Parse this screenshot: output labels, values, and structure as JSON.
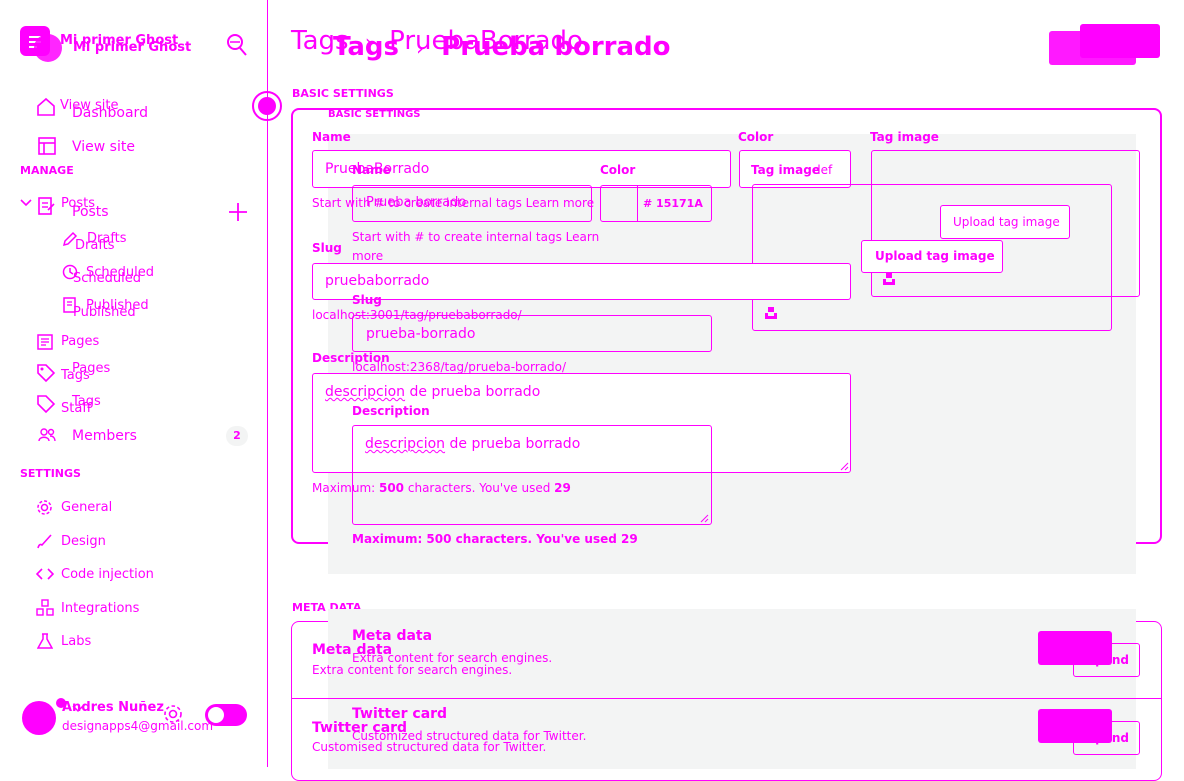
{
  "site": {
    "name": "Mi primer Ghost"
  },
  "nav": {
    "view_site": "View site",
    "dashboard": "Dashboard",
    "view_site_2": "View site",
    "manage_header": "MANAGE",
    "posts": "Posts",
    "drafts": "Drafts",
    "scheduled": "Scheduled",
    "published": "Published",
    "pages": "Pages",
    "tags": "Tags",
    "staff": "Staff",
    "members": "Members",
    "members_count": "2",
    "settings_header": "SETTINGS",
    "general": "General",
    "design": "Design",
    "code_injection": "Code injection",
    "integrations": "Integrations",
    "labs": "Labs"
  },
  "user": {
    "name": "Andres Nuñez",
    "email": "designapps4@gmail.com"
  },
  "header": {
    "crumb_a": "Tags",
    "sep_a": "›",
    "title_a": "PruebaBorrado",
    "crumb_b": "Tags",
    "sep_b": "›",
    "title_b": "Prueba borrado"
  },
  "basic": {
    "section_a": "BASIC SETTINGS",
    "section_b": "BASIC SETTINGS",
    "name_label": "Name",
    "name_value": "PruebaBorrado",
    "name_label_b": "Name",
    "name_value_b": "Prueba borrado",
    "name_hint_a": "Start with # to create internal tags Learn more",
    "name_hint_b1": "Start with # to create internal tags Learn",
    "name_hint_b2": "more",
    "color_label_a": "Color",
    "color_label_b": "Color",
    "color_hex_a": "15171A",
    "color_hex_b": "# 15171A",
    "color_def": "def",
    "tag_image_label_a": "Tag image",
    "tag_image_label_b": "Tag image",
    "upload_a": "Upload tag image",
    "upload_b": "Upload tag image",
    "slug_label_a": "Slug",
    "slug_value_a": "pruebaborrado",
    "slug_url_a": "localhost:3001/tag/pruebaborrado/",
    "slug_label_b": "Slug",
    "slug_value_b": "prueba-borrado",
    "slug_url_b": "localhost:2368/tag/prueba-borrado/",
    "desc_label_a": "Description",
    "desc_label_b": "Description",
    "desc_value": "descripcion de prueba borrado",
    "desc_word": "descripcion",
    "desc_rest": " de prueba borrado",
    "max_pre": "Maximum: ",
    "max_num": "500",
    "max_mid": " characters. You've used ",
    "max_used": "29"
  },
  "meta": {
    "section": "META DATA",
    "meta_title_b": "Meta data",
    "meta_desc_b": "Extra content for search engines.",
    "meta_title_a": "Meta data",
    "meta_desc_a": "Extra content for search engines.",
    "expand": "Expand",
    "twitter_title_b": "Twitter card",
    "twitter_desc_b": "Customized structured data for Twitter.",
    "twitter_title_a": "Twitter card",
    "twitter_desc_a": "Customised structured data for Twitter."
  },
  "colors": {
    "accent": "#ff00ff",
    "panel": "#f3f4f4",
    "text": "#15171A"
  }
}
